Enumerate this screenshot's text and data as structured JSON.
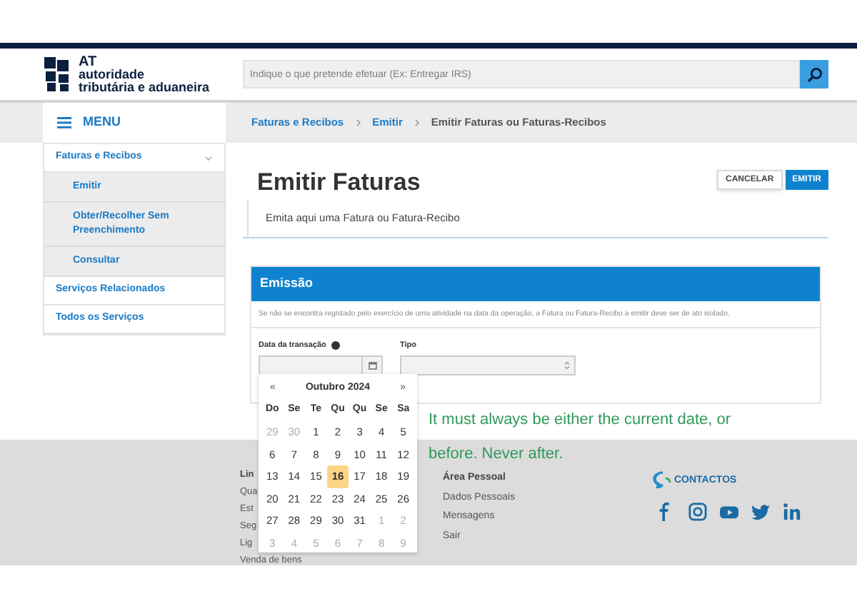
{
  "header": {
    "logo": {
      "abbr": "AT",
      "line1": "autoridade",
      "line2": "tributária e aduaneira"
    },
    "search": {
      "placeholder": "Indique o que pretende efetuar (Ex: Entregar IRS)"
    }
  },
  "menu": {
    "label": "MENU"
  },
  "breadcrumbs": [
    {
      "label": "Faturas e Recibos",
      "current": false
    },
    {
      "label": "Emitir",
      "current": false
    },
    {
      "label": "Emitir Faturas ou Faturas-Recibos",
      "current": true
    }
  ],
  "sidebar": {
    "items": [
      {
        "label": "Faturas e Recibos",
        "expanded": true,
        "children": [
          {
            "label": "Emitir"
          },
          {
            "label": "Obter/Recolher Sem Preenchimento"
          },
          {
            "label": "Consultar"
          }
        ]
      },
      {
        "label": "Serviços Relacionados"
      },
      {
        "label": "Todos os Serviços"
      }
    ]
  },
  "page": {
    "title": "Emitir Faturas",
    "subtitle": "Emita aqui uma Fatura ou Fatura-Recibo",
    "buttons": [
      {
        "label": "CANCELAR",
        "kind": "secondary"
      },
      {
        "label": "EMITIR",
        "kind": "primary"
      }
    ]
  },
  "panel": {
    "title": "Emissão",
    "notice": "Se não se encontra registado pelo exercício de uma atividade na data da operação, a Fatura ou Fatura-Recibo a emitir deve ser de ato isolado.",
    "fields": [
      {
        "label": "Data da transação",
        "kind": "date",
        "help": true
      },
      {
        "label": "Tipo",
        "kind": "select"
      }
    ]
  },
  "calendar": {
    "prev": "«",
    "month": "Outubro 2024",
    "next": "»",
    "weekdays": [
      "Do",
      "Se",
      "Te",
      "Qu",
      "Qu",
      "Se",
      "Sa"
    ],
    "days": [
      {
        "label": "29",
        "muted": true,
        "selected": false
      },
      {
        "label": "30",
        "muted": true,
        "selected": false
      },
      {
        "label": "1",
        "muted": false,
        "selected": false
      },
      {
        "label": "2",
        "muted": false,
        "selected": false
      },
      {
        "label": "3",
        "muted": false,
        "selected": false
      },
      {
        "label": "4",
        "muted": false,
        "selected": false
      },
      {
        "label": "5",
        "muted": false,
        "selected": false
      },
      {
        "label": "6",
        "muted": false,
        "selected": false
      },
      {
        "label": "7",
        "muted": false,
        "selected": false
      },
      {
        "label": "8",
        "muted": false,
        "selected": false
      },
      {
        "label": "9",
        "muted": false,
        "selected": false
      },
      {
        "label": "10",
        "muted": false,
        "selected": false
      },
      {
        "label": "11",
        "muted": false,
        "selected": false
      },
      {
        "label": "12",
        "muted": false,
        "selected": false
      },
      {
        "label": "13",
        "muted": false,
        "selected": false
      },
      {
        "label": "14",
        "muted": false,
        "selected": false
      },
      {
        "label": "15",
        "muted": false,
        "selected": false
      },
      {
        "label": "16",
        "muted": false,
        "selected": true
      },
      {
        "label": "17",
        "muted": false,
        "selected": false
      },
      {
        "label": "18",
        "muted": false,
        "selected": false
      },
      {
        "label": "19",
        "muted": false,
        "selected": false
      },
      {
        "label": "20",
        "muted": false,
        "selected": false
      },
      {
        "label": "21",
        "muted": false,
        "selected": false
      },
      {
        "label": "22",
        "muted": false,
        "selected": false
      },
      {
        "label": "23",
        "muted": false,
        "selected": false
      },
      {
        "label": "24",
        "muted": false,
        "selected": false
      },
      {
        "label": "25",
        "muted": false,
        "selected": false
      },
      {
        "label": "26",
        "muted": false,
        "selected": false
      },
      {
        "label": "27",
        "muted": false,
        "selected": false
      },
      {
        "label": "28",
        "muted": false,
        "selected": false
      },
      {
        "label": "29",
        "muted": false,
        "selected": false
      },
      {
        "label": "30",
        "muted": false,
        "selected": false
      },
      {
        "label": "31",
        "muted": false,
        "selected": false
      },
      {
        "label": "1",
        "muted": true,
        "selected": false
      },
      {
        "label": "2",
        "muted": true,
        "selected": false
      },
      {
        "label": "3",
        "muted": true,
        "selected": false
      },
      {
        "label": "4",
        "muted": true,
        "selected": false
      },
      {
        "label": "5",
        "muted": true,
        "selected": false
      },
      {
        "label": "6",
        "muted": true,
        "selected": false
      },
      {
        "label": "7",
        "muted": true,
        "selected": false
      },
      {
        "label": "8",
        "muted": true,
        "selected": false
      },
      {
        "label": "9",
        "muted": true,
        "selected": false
      }
    ]
  },
  "annotation": "It must always be either the current date, or before. Never after.",
  "footer": {
    "column_1": [
      "Lin",
      "Qua",
      "Est",
      "Seg",
      "Lig",
      "Venda de bens"
    ],
    "area_pessoal": {
      "title": "Área Pessoal",
      "links": [
        "Dados Pessoais",
        "Mensagens",
        "Sair"
      ]
    },
    "contacts": {
      "label": "CONTACTOS"
    }
  }
}
